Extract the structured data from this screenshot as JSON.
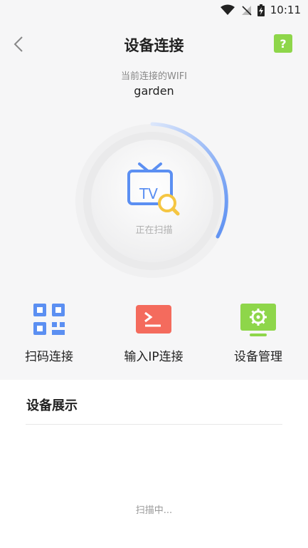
{
  "status_bar": {
    "time": "10:11"
  },
  "header": {
    "title": "设备连接",
    "help_label": "?"
  },
  "wifi": {
    "label": "当前连接的WIFI",
    "name": "garden"
  },
  "scanner": {
    "tv_text": "TV",
    "status": "正在扫描"
  },
  "actions": [
    {
      "label": "扫码连接",
      "icon": "qr-code-icon"
    },
    {
      "label": "输入IP连接",
      "icon": "terminal-icon"
    },
    {
      "label": "设备管理",
      "icon": "device-settings-icon"
    }
  ],
  "device_panel": {
    "title": "设备展示",
    "status": "扫描中..."
  },
  "colors": {
    "accent_blue": "#5b8ff2",
    "help_green": "#8ed64a",
    "ip_red": "#f46b5d",
    "manage_green": "#8ed64a"
  }
}
